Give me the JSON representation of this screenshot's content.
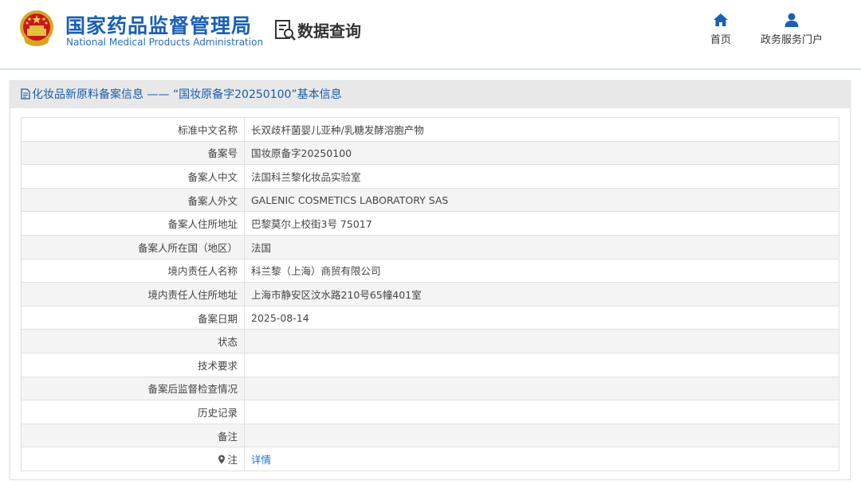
{
  "header": {
    "org_name_cn": "国家药品监督管理局",
    "org_name_en": "National Medical Products Administration",
    "data_query_label": "数据查询",
    "nav": [
      {
        "label": "首页",
        "icon": "home-icon"
      },
      {
        "label": "政务服务门户",
        "icon": "user-icon"
      }
    ]
  },
  "panel": {
    "title": "化妆品新原料备案信息 —— “国妆原备字20250100”基本信息",
    "title_icon": "document-icon"
  },
  "rows": [
    {
      "label": "标准中文名称",
      "value": "长双歧杆菌婴儿亚种/乳糖发酵溶胞产物"
    },
    {
      "label": "备案号",
      "value": "国妆原备字20250100"
    },
    {
      "label": "备案人中文",
      "value": "法国科兰黎化妆品实验室"
    },
    {
      "label": "备案人外文",
      "value": "GALENIC COSMETICS LABORATORY SAS"
    },
    {
      "label": "备案人住所地址",
      "value": "巴黎莫尔上校街3号 75017"
    },
    {
      "label": "备案人所在国（地区）",
      "value": "法国"
    },
    {
      "label": "境内责任人名称",
      "value": "科兰黎（上海）商贸有限公司"
    },
    {
      "label": "境内责任人住所地址",
      "value": "上海市静安区汶水路210号65幢401室"
    },
    {
      "label": "备案日期",
      "value": "2025-08-14"
    },
    {
      "label": "状态",
      "value": ""
    },
    {
      "label": "技术要求",
      "value": ""
    },
    {
      "label": "备案后监督检查情况",
      "value": ""
    },
    {
      "label": "历史记录",
      "value": ""
    },
    {
      "label": "备注",
      "value": ""
    }
  ],
  "note_row": {
    "label": "注",
    "icon": "map-pin-icon",
    "link": "详情"
  },
  "colors": {
    "brand_blue": "#1b5fb3",
    "link_blue": "#1a73d9",
    "title_bar": "#e8e8e8"
  }
}
